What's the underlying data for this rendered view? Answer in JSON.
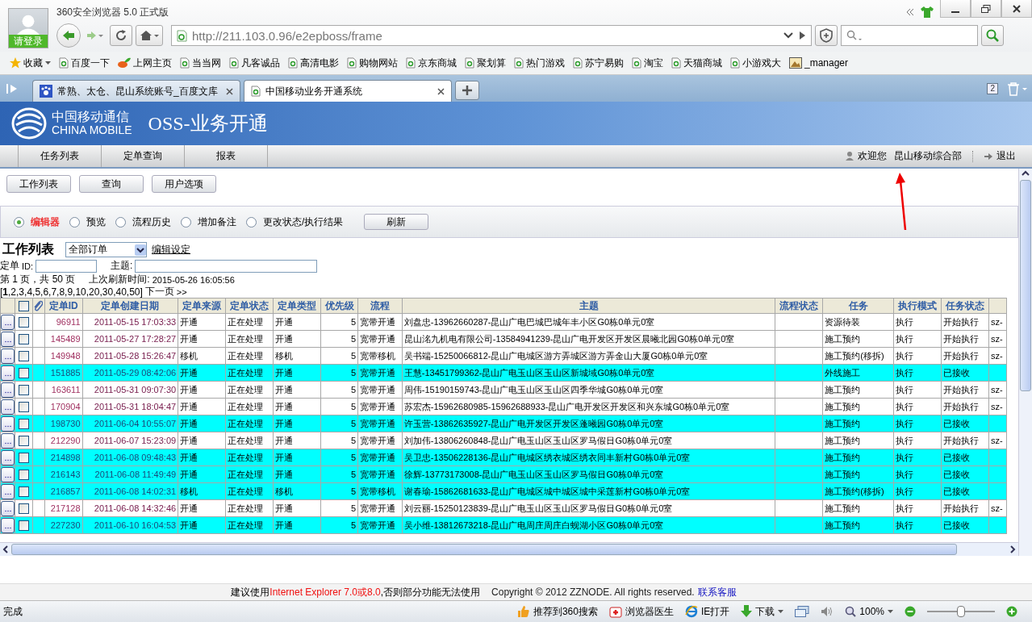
{
  "browser": {
    "title": "360安全浏览器 5.0 正式版",
    "login": "请登录",
    "address": "http://211.103.0.96/e2epboss/frame",
    "bookmarks": [
      {
        "label": "收藏",
        "kind": "favorites"
      },
      {
        "label": "百度一下",
        "kind": "page"
      },
      {
        "label": "上网主页",
        "kind": "logo"
      },
      {
        "label": "当当网",
        "kind": "page"
      },
      {
        "label": "凡客诚品",
        "kind": "page"
      },
      {
        "label": "高清电影",
        "kind": "page"
      },
      {
        "label": "购物网站",
        "kind": "page"
      },
      {
        "label": "京东商城",
        "kind": "page"
      },
      {
        "label": "聚划算",
        "kind": "page"
      },
      {
        "label": "热门游戏",
        "kind": "page"
      },
      {
        "label": "苏宁易购",
        "kind": "page"
      },
      {
        "label": "淘宝",
        "kind": "page"
      },
      {
        "label": "天猫商城",
        "kind": "page"
      },
      {
        "label": "小游戏大",
        "kind": "page"
      },
      {
        "label": "_manager",
        "kind": "image"
      }
    ],
    "tabs": [
      {
        "label": "常熟、太仓、昆山系统账号_百度文库",
        "selected": false
      },
      {
        "label": "中国移动业务开通系统",
        "selected": true
      }
    ],
    "closed_tabs": "2"
  },
  "header": {
    "logo_cn": "中国移动通信",
    "logo_en": "CHINA MOBILE",
    "title": "OSS-业务开通"
  },
  "nav": {
    "items": [
      "任务列表",
      "定单查询",
      "报表"
    ],
    "welcome": "欢迎您",
    "user": "昆山移动综合部",
    "logout": "退出"
  },
  "toolbar": [
    "工作列表",
    "查询",
    "用户选项"
  ],
  "views": {
    "options": [
      {
        "label": "编辑器",
        "selected": true
      },
      {
        "label": "预览",
        "selected": false
      },
      {
        "label": "流程历史",
        "selected": false
      },
      {
        "label": "增加备注",
        "selected": false
      },
      {
        "label": "更改状态/执行结果",
        "selected": false
      }
    ],
    "refresh": "刷新"
  },
  "worklist": {
    "title": "工作列表",
    "filter": "全部订单",
    "edit_settings": "编辑设定",
    "order_label": "定单",
    "id_label": "ID:",
    "subject_label": "主题:",
    "page_info": "第 1 页，共 50 页",
    "refresh_label": "上次刷新时间:",
    "refresh_time": "2015-05-26 16:05:56",
    "pager": "[**1**,2,3,4,5,6,7,8,9,10,20,30,40,50]",
    "next": "下一页",
    "next_arrows": ">>"
  },
  "table": {
    "select_all": {
      "checked": false
    },
    "columns": [
      "定单ID",
      "定单创建日期",
      "定单来源",
      "定单状态",
      "定单类型",
      "优先级",
      "流程",
      "主题",
      "流程状态",
      "任务",
      "执行模式",
      "任务状态"
    ],
    "rows": [
      {
        "id": "96911",
        "date": "2011-05-15 17:03:33",
        "source": "开通",
        "status": "正在处理",
        "type": "开通",
        "priority": "5",
        "flow": "宽带开通",
        "subject": "刘盘忠-13962660287-昆山广电巴城巴城年丰小区G0栋0单元0室",
        "task": "资源待装",
        "mode": "执行",
        "task_state": "开始执行",
        "column_14": "sz-",
        "highlighted": false,
        "checked": false
      },
      {
        "id": "145489",
        "date": "2011-05-27 17:28:27",
        "source": "开通",
        "status": "正在处理",
        "type": "开通",
        "priority": "5",
        "flow": "宽带开通",
        "subject": "昆山洺九机电有限公司-13584941239-昆山广电开发区开发区晨曦北园G0栋0单元0室",
        "task": "施工预约",
        "mode": "执行",
        "task_state": "开始执行",
        "column_14": "sz-",
        "highlighted": false,
        "checked": false
      },
      {
        "id": "149948",
        "date": "2011-05-28 15:26:47",
        "source": "移机",
        "status": "正在处理",
        "type": "移机",
        "priority": "5",
        "flow": "宽带移机",
        "subject": "吴书端-15250066812-昆山广电城区游方弄城区游方弄金山大厦G0栋0单元0室",
        "task": "施工预约(移拆)",
        "mode": "执行",
        "task_state": "开始执行",
        "column_14": "sz-",
        "highlighted": false,
        "checked": false
      },
      {
        "id": "151885",
        "date": "2011-05-29 08:42:06",
        "source": "开通",
        "status": "正在处理",
        "type": "开通",
        "priority": "5",
        "flow": "宽带开通",
        "subject": "王慧-13451799362-昆山广电玉山区玉山区新城域G0栋0单元0室",
        "task": "外线施工",
        "mode": "执行",
        "task_state": "已接收",
        "highlighted": true,
        "checked": false
      },
      {
        "id": "163611",
        "date": "2011-05-31 09:07:30",
        "source": "开通",
        "status": "正在处理",
        "type": "开通",
        "priority": "5",
        "flow": "宽带开通",
        "subject": "周伟-15190159743-昆山广电玉山区玉山区四季华城G0栋0单元0室",
        "task": "施工预约",
        "mode": "执行",
        "task_state": "开始执行",
        "column_14": "sz-",
        "highlighted": false,
        "checked": false
      },
      {
        "id": "170904",
        "date": "2011-05-31 18:04:47",
        "source": "开通",
        "status": "正在处理",
        "type": "开通",
        "priority": "5",
        "flow": "宽带开通",
        "subject": "苏宏杰-15962680985-15962688933-昆山广电开发区开发区和兴东城G0栋0单元0室",
        "task": "施工预约",
        "mode": "执行",
        "task_state": "开始执行",
        "column_14": "sz-",
        "highlighted": false,
        "checked": false
      },
      {
        "id": "198730",
        "date": "2011-06-04 10:55:07",
        "source": "开通",
        "status": "正在处理",
        "type": "开通",
        "priority": "5",
        "flow": "宽带开通",
        "subject": "许玉营-13862635927-昆山广电开发区开发区蓬曦园G0栋0单元0室",
        "task": "施工预约",
        "mode": "执行",
        "task_state": "已接收",
        "highlighted": true,
        "checked": false
      },
      {
        "id": "212290",
        "date": "2011-06-07 15:23:09",
        "source": "开通",
        "status": "正在处理",
        "type": "开通",
        "priority": "5",
        "flow": "宽带开通",
        "subject": "刘加伟-13806260848-昆山广电玉山区玉山区罗马假日G0栋0单元0室",
        "task": "施工预约",
        "mode": "执行",
        "task_state": "开始执行",
        "column_14": "sz-",
        "highlighted": false,
        "checked": false
      },
      {
        "id": "214898",
        "date": "2011-06-08 09:48:43",
        "source": "开通",
        "status": "正在处理",
        "type": "开通",
        "priority": "5",
        "flow": "宽带开通",
        "subject": "吴卫忠-13506228136-昆山广电城区绣衣城区绣衣同丰新村G0栋0单元0室",
        "task": "施工预约",
        "mode": "执行",
        "task_state": "已接收",
        "highlighted": true,
        "checked": false
      },
      {
        "id": "216143",
        "date": "2011-06-08 11:49:49",
        "source": "开通",
        "status": "正在处理",
        "type": "开通",
        "priority": "5",
        "flow": "宽带开通",
        "subject": "徐辉-13773173008-昆山广电玉山区玉山区罗马假日G0栋0单元0室",
        "task": "施工预约",
        "mode": "执行",
        "task_state": "已接收",
        "highlighted": true,
        "checked": false
      },
      {
        "id": "216857",
        "date": "2011-06-08 14:02:31",
        "source": "移机",
        "status": "正在处理",
        "type": "移机",
        "priority": "5",
        "flow": "宽带移机",
        "subject": "谢春瑜-15862681633-昆山广电城区城中城区城中采莲新村G0栋0单元0室",
        "task": "施工预约(移拆)",
        "mode": "执行",
        "task_state": "已接收",
        "highlighted": true,
        "checked": false
      },
      {
        "id": "217128",
        "date": "2011-06-08 14:32:46",
        "source": "开通",
        "status": "正在处理",
        "type": "开通",
        "priority": "5",
        "flow": "宽带开通",
        "subject": "刘云丽-15250123839-昆山广电玉山区玉山区罗马假日G0栋0单元0室",
        "task": "施工预约",
        "mode": "执行",
        "task_state": "开始执行",
        "column_14": "sz-",
        "highlighted": false,
        "checked": false
      },
      {
        "id": "227230",
        "date": "2011-06-10 16:04:53",
        "source": "开通",
        "status": "正在处理",
        "type": "开通",
        "priority": "5",
        "flow": "宽带开通",
        "subject": "吴小维-13812673218-昆山广电周庄周庄白蚬湖小区G0栋0单元0室",
        "task": "施工预约",
        "mode": "执行",
        "task_state": "已接收",
        "highlighted": true,
        "checked": false
      }
    ]
  },
  "footer": {
    "recommend": "建议使用",
    "browser_version": "Internet Explorer 7.0或8.0",
    "warning": ",否则部分功能无法使用",
    "copyright": "Copyright © 2012 ZZNODE. All rights reserved.",
    "contact": "联系客服"
  },
  "status_bar": {
    "text": "完成",
    "items": [
      {
        "label": "推荐到360搜索",
        "kind": "thumb"
      },
      {
        "label": "浏览器医生",
        "kind": "medkit"
      },
      {
        "label": "IE打开",
        "kind": "ie"
      },
      {
        "label": "下载",
        "kind": "download"
      }
    ],
    "zoom": "100%",
    "zoom_slider": {
      "level": 0.5
    }
  }
}
